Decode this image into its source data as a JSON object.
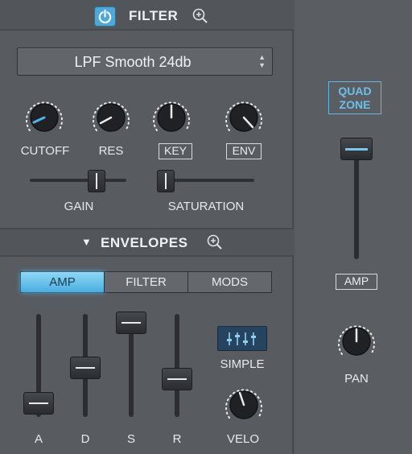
{
  "filter": {
    "title": "FILTER",
    "power_on": true,
    "preset": "LPF Smooth 24db",
    "knobs": [
      {
        "label": "CUTOFF",
        "boxed": false
      },
      {
        "label": "RES",
        "boxed": false
      },
      {
        "label": "KEY",
        "boxed": true
      },
      {
        "label": "ENV",
        "boxed": true
      }
    ],
    "gain_label": "GAIN",
    "saturation_label": "SATURATION"
  },
  "envelopes": {
    "title": "ENVELOPES",
    "tabs": [
      "AMP",
      "FILTER",
      "MODS"
    ],
    "active_tab": "AMP",
    "faders": [
      "A",
      "D",
      "S",
      "R"
    ],
    "simple_label": "SIMPLE",
    "velo_label": "VELO"
  },
  "right": {
    "quad_zone_line1": "QUAD",
    "quad_zone_line2": "ZONE",
    "amp_label": "AMP",
    "pan_label": "PAN"
  },
  "colors": {
    "accent": "#4fa9d8",
    "panel": "#585b60"
  },
  "icons": {
    "power": "power-icon",
    "zoom": "zoom-in-icon",
    "collapse": "triangle-down-icon",
    "eq": "eq-sliders-icon"
  }
}
